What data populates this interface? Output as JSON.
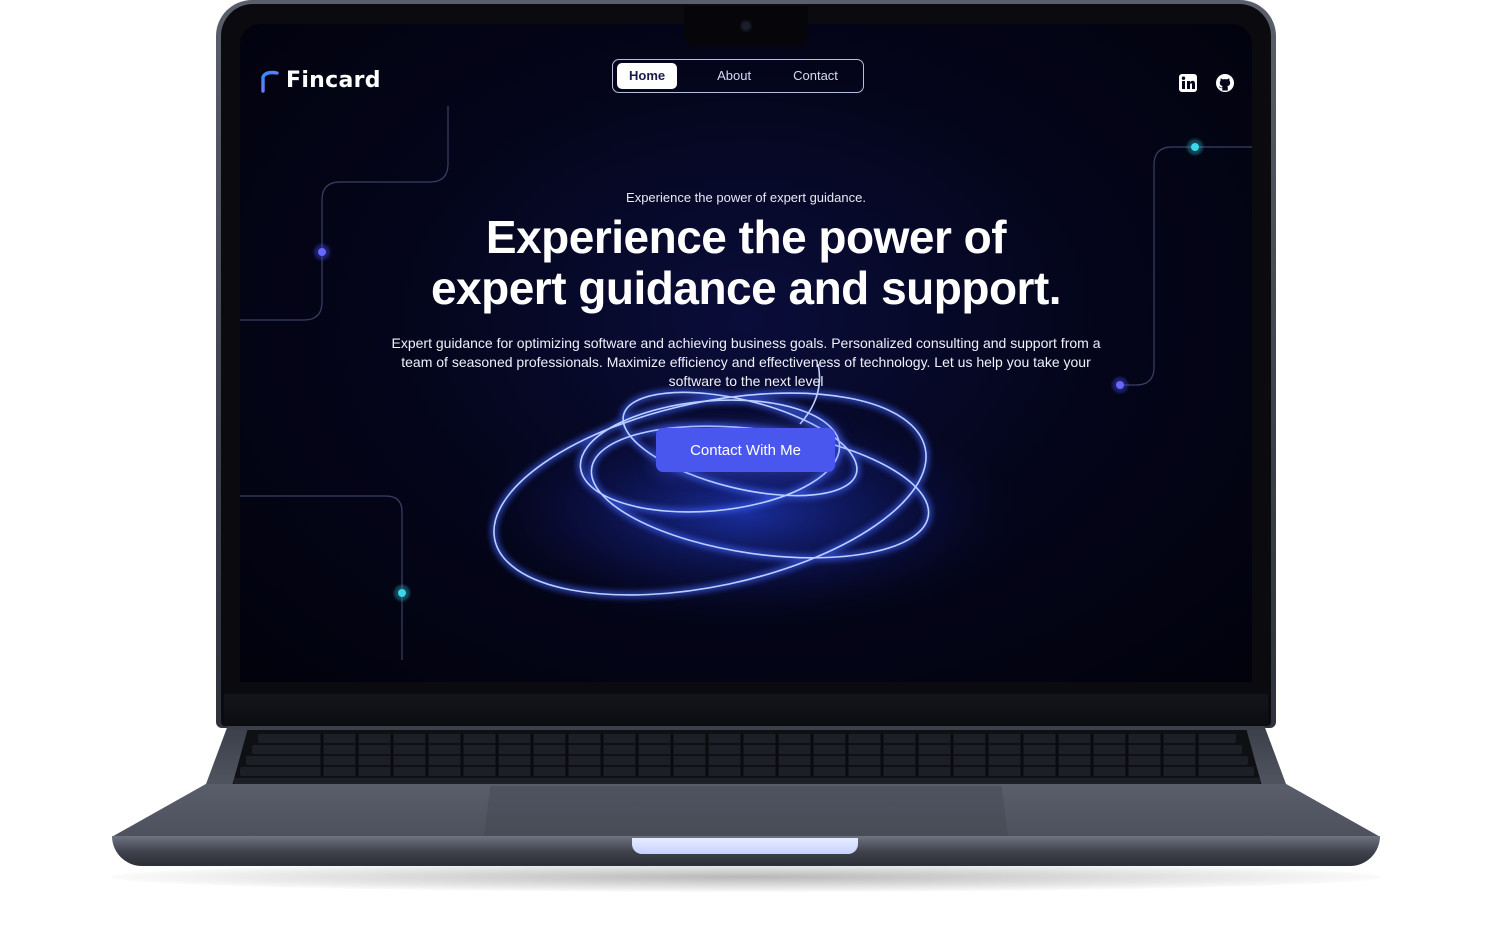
{
  "site": {
    "logo_text": "Fincard",
    "nav": {
      "items": [
        {
          "label": "Home",
          "active": true
        },
        {
          "label": "About",
          "active": false
        },
        {
          "label": "Contact",
          "active": false
        }
      ]
    },
    "social": [
      "linkedin-icon",
      "github-icon"
    ]
  },
  "hero": {
    "eyebrow": "Experience the power of expert guidance.",
    "headline_line1": "Experience the power of",
    "headline_line2": "expert guidance and support.",
    "description": "Expert guidance for optimizing software and achieving business goals. Personalized consulting and support from a team of seasoned professionals. Maximize efficiency and effectiveness of technology. Let us help you take your software to the next level",
    "cta_label": "Contact With Me"
  },
  "colors": {
    "background": "#04051a",
    "accent": "#4a57ef",
    "dot_blue": "#5b5cff",
    "dot_teal": "#2ec4d6",
    "logo_gradient_start": "#2f8cff",
    "logo_gradient_end": "#9b6bff"
  }
}
